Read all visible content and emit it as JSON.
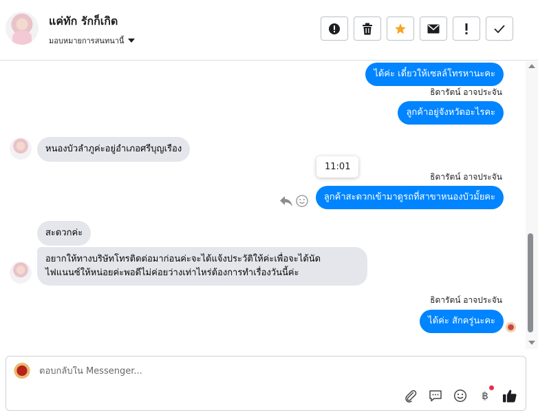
{
  "header": {
    "contact_name": "แค่ทัก รักก็เกิด",
    "assign_label": "มอบหมายการสนทนานี้",
    "actions": [
      {
        "name": "spam-button",
        "icon": "exclamation-circle-icon"
      },
      {
        "name": "delete-button",
        "icon": "trash-icon"
      },
      {
        "name": "star-button",
        "icon": "star-icon",
        "color": "#f5a623"
      },
      {
        "name": "mark-unread-button",
        "icon": "envelope-icon"
      },
      {
        "name": "follow-up-button",
        "icon": "exclamation-icon"
      },
      {
        "name": "done-button",
        "icon": "check-icon"
      }
    ]
  },
  "messages": {
    "m1": "ได้ค่ะ เดี๋ยวให้เซลล์โทรหานะคะ",
    "sender1": "ธิดารัตน์ อาจประจัน",
    "m2": "ลูกค้าอยู่จังหวัดอะไรคะ",
    "m3": "หนองบัวลำภูค่ะอยู่อำเภอศรีบุญเรือง",
    "tooltip_time": "11:01",
    "sender2": "ธิดารัตน์ อาจประจัน",
    "m4": "ลูกค้าสะดวกเข้ามาดูรถที่สาขาหนองบัวมั้ยคะ",
    "m5": "สะดวกค่ะ",
    "m6_line1": "อยากให้ทางบริษัทโทรติดต่อมาก่อนค่ะจะได้แจ้งประวัติให้ค่ะเพื่อจะได้นัด",
    "m6_line2": "ไฟแนนซ์ให้หน่อยค่ะพอดีไม่ค่อยว่างเท่าไหร่ต้องการทำเรื่องวันนี้ค่ะ",
    "sender3": "ธิดารัตน์ อาจประจัน",
    "m7": "ได้ค่ะ สักครู่นะคะ"
  },
  "composer": {
    "placeholder": "ตอบกลับใน Messenger..."
  },
  "colors": {
    "outgoing_bubble": "#0084ff",
    "incoming_bubble": "#e4e6eb",
    "notification_dot": "#f02849"
  }
}
